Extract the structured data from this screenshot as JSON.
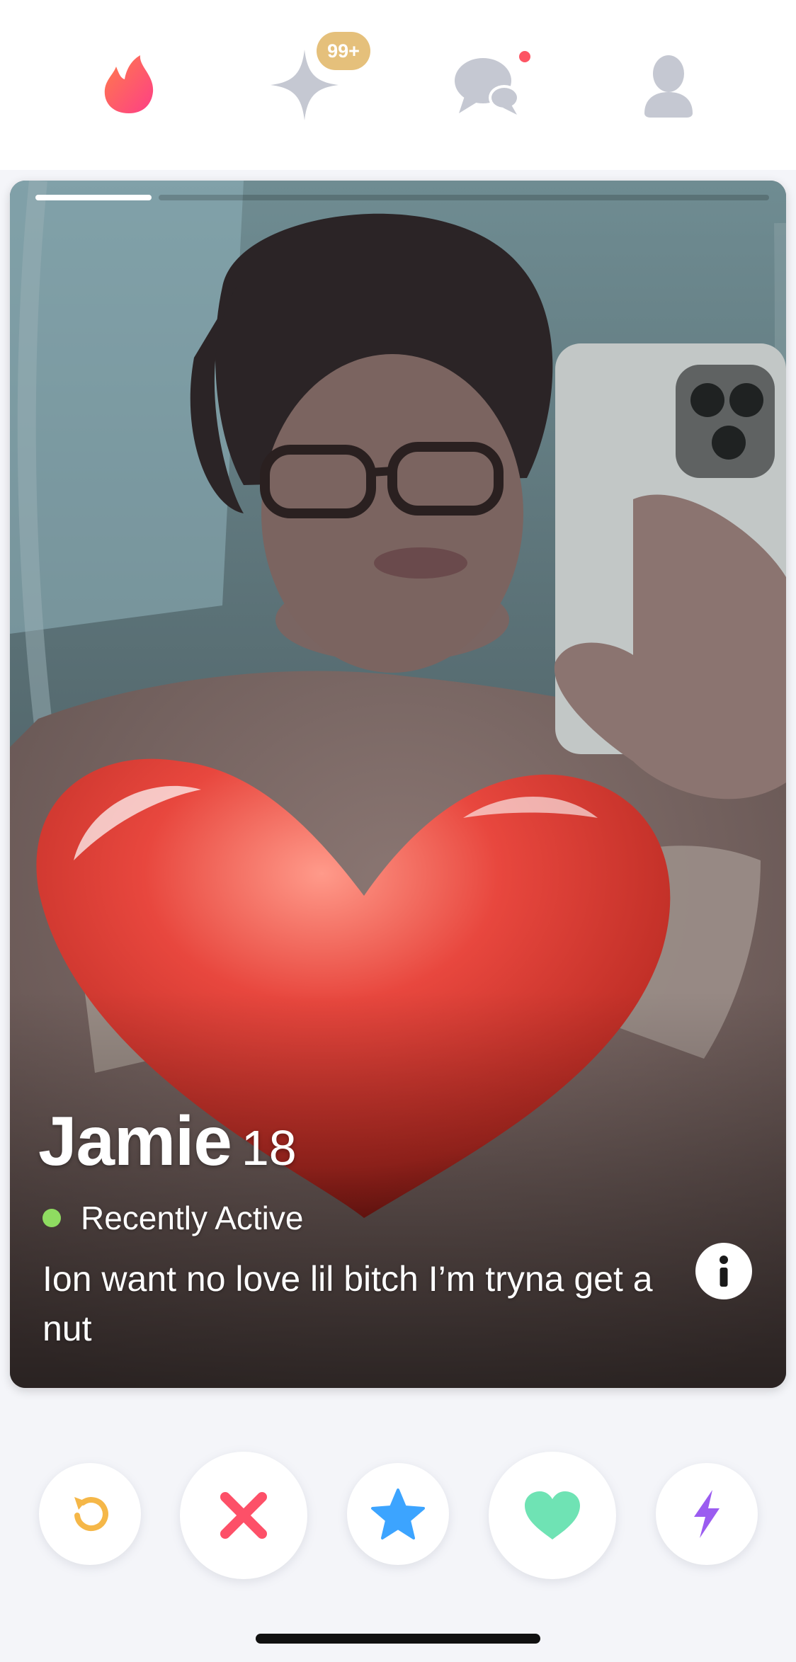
{
  "nav": {
    "items": [
      {
        "icon": "flame-icon",
        "color": "#fd4d6a"
      },
      {
        "icon": "sparkle-icon",
        "color": "#c5c8d2",
        "badge": "99+"
      },
      {
        "icon": "chat-icon",
        "color": "#c5c8d2",
        "notification": true
      },
      {
        "icon": "profile-icon",
        "color": "#c5c8d2"
      }
    ],
    "badge_color": "#e5c07b",
    "notification_color": "#fd5564"
  },
  "card": {
    "name": "Jamie",
    "age": "18",
    "status": "Recently Active",
    "status_color": "#8fdc61",
    "bio": "Ion want no love lil bitch I’m tryna get a nut",
    "photo_count_visible": 1,
    "info_icon": "info-icon"
  },
  "actions": [
    {
      "name": "rewind",
      "icon": "rewind-icon",
      "color": "#f5b748"
    },
    {
      "name": "nope",
      "icon": "close-icon",
      "color": "#fd5068"
    },
    {
      "name": "super-like",
      "icon": "star-icon",
      "color": "#3ca4ff"
    },
    {
      "name": "like",
      "icon": "heart-icon",
      "color": "#6fe3b4"
    },
    {
      "name": "boost",
      "icon": "lightning-icon",
      "color": "#9b5cf0"
    }
  ]
}
